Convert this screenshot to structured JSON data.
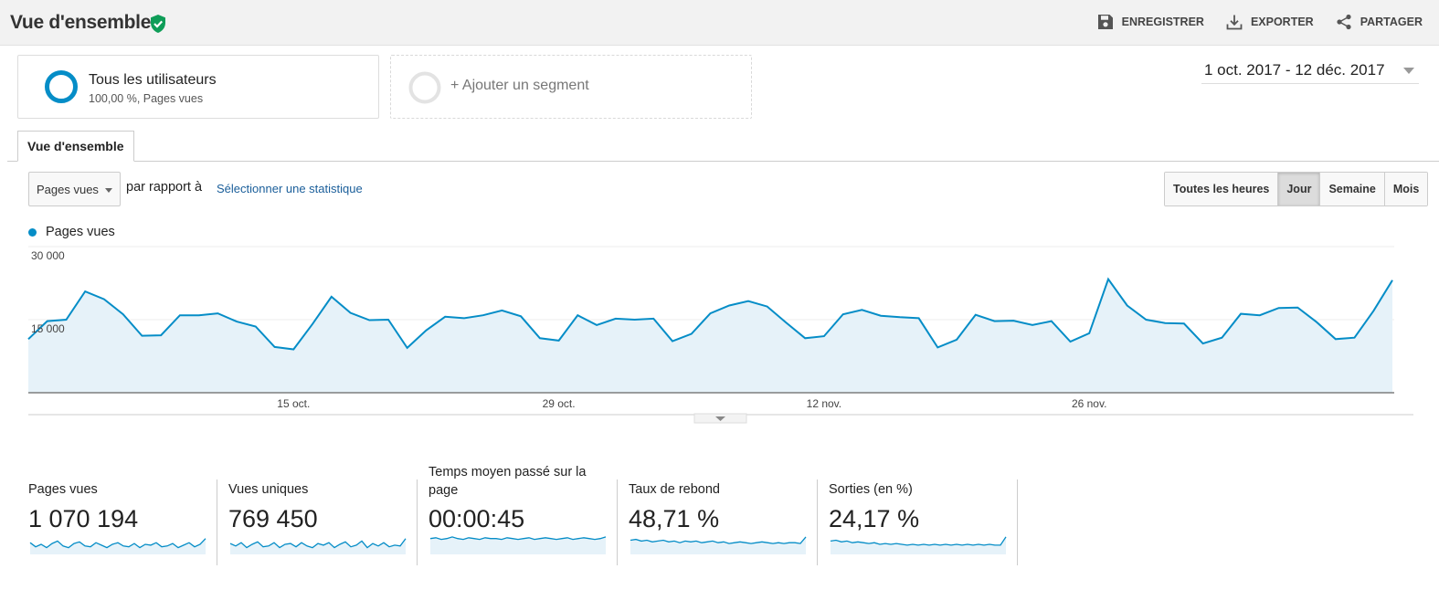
{
  "header": {
    "title": "Vue d'ensemble",
    "actions": [
      {
        "label": "ENREGISTRER",
        "icon": "save-icon"
      },
      {
        "label": "EXPORTER",
        "icon": "download-icon"
      },
      {
        "label": "PARTAGER",
        "icon": "share-icon"
      }
    ]
  },
  "segments": {
    "active": {
      "name": "Tous les utilisateurs",
      "detail": "100,00 %, Pages vues"
    },
    "add_label": "+ Ajouter un segment"
  },
  "date_range": "1 oct. 2017 - 12 déc. 2017",
  "tab": "Vue d'ensemble",
  "controls": {
    "metric": "Pages vues",
    "versus": "par rapport à",
    "select_stat": "Sélectionner une statistique",
    "granularity": [
      "Toutes les heures",
      "Jour",
      "Semaine",
      "Mois"
    ],
    "active_granularity": "Jour"
  },
  "colors": {
    "accent": "#058dc7",
    "area": "#e6f2f9",
    "good": "#0f9d58"
  },
  "chart_data": {
    "type": "area",
    "series": [
      {
        "name": "Pages vues"
      }
    ],
    "yticks": [
      "30 000",
      "15 000"
    ],
    "ylim": [
      0,
      30000
    ],
    "xticks": [
      "15 oct.",
      "29 oct.",
      "12 nov.",
      "26 nov."
    ],
    "x_tick_days": [
      14,
      28,
      42,
      56
    ],
    "x_start": "1 oct. 2017",
    "values": [
      11000,
      14700,
      15000,
      20800,
      19200,
      16100,
      11700,
      11800,
      15900,
      15900,
      16300,
      14600,
      13600,
      9400,
      8900,
      14100,
      19700,
      16400,
      14900,
      15000,
      9200,
      12800,
      15600,
      15300,
      15900,
      16900,
      15700,
      11200,
      10700,
      15900,
      13900,
      15200,
      15000,
      15200,
      10600,
      12100,
      16300,
      17900,
      18800,
      17700,
      14400,
      11200,
      11600,
      16100,
      17000,
      15800,
      15500,
      15300,
      9300,
      10900,
      16000,
      14700,
      14800,
      13900,
      14700,
      10500,
      12200,
      23300,
      17900,
      15000,
      14300,
      14200,
      10100,
      11300,
      16200,
      15900,
      17400,
      17500,
      14500,
      11000,
      11300,
      16800,
      23100
    ]
  },
  "kpis": [
    {
      "label": "Pages vues",
      "value": "1 070 194",
      "spark": [
        0.6,
        0.35,
        0.5,
        0.3,
        0.55,
        0.7,
        0.4,
        0.3,
        0.55,
        0.65,
        0.4,
        0.35,
        0.6,
        0.45,
        0.3,
        0.5,
        0.6,
        0.4,
        0.35,
        0.55,
        0.3,
        0.5,
        0.45,
        0.6,
        0.35,
        0.4,
        0.55,
        0.3,
        0.45,
        0.6,
        0.35,
        0.5,
        0.85
      ]
    },
    {
      "label": "Vues uniques",
      "value": "769 450",
      "spark": [
        0.55,
        0.4,
        0.6,
        0.3,
        0.5,
        0.65,
        0.35,
        0.4,
        0.6,
        0.3,
        0.5,
        0.55,
        0.35,
        0.6,
        0.4,
        0.3,
        0.55,
        0.45,
        0.6,
        0.3,
        0.5,
        0.65,
        0.35,
        0.45,
        0.7,
        0.3,
        0.55,
        0.4,
        0.6,
        0.35,
        0.45,
        0.4,
        0.85
      ]
    },
    {
      "label": "Temps moyen passé sur la page",
      "value": "00:00:45",
      "spark": [
        0.85,
        0.9,
        0.8,
        0.85,
        0.95,
        0.85,
        0.8,
        0.9,
        0.85,
        0.8,
        0.9,
        0.85,
        0.85,
        0.8,
        0.9,
        0.85,
        0.8,
        0.85,
        0.9,
        0.8,
        0.85,
        0.9,
        0.85,
        0.8,
        0.85,
        0.9,
        0.8,
        0.85,
        0.9,
        0.85,
        0.8,
        0.85,
        0.95
      ]
    },
    {
      "label": "Taux de rebond",
      "value": "48,71 %",
      "spark": [
        0.75,
        0.8,
        0.7,
        0.75,
        0.65,
        0.7,
        0.75,
        0.65,
        0.7,
        0.6,
        0.7,
        0.65,
        0.7,
        0.6,
        0.65,
        0.7,
        0.6,
        0.65,
        0.55,
        0.6,
        0.65,
        0.6,
        0.55,
        0.6,
        0.65,
        0.6,
        0.55,
        0.6,
        0.55,
        0.6,
        0.6,
        0.55,
        0.95
      ]
    },
    {
      "label": "Sorties (en %)",
      "value": "24,17 %",
      "spark": [
        0.7,
        0.75,
        0.65,
        0.7,
        0.6,
        0.65,
        0.6,
        0.55,
        0.6,
        0.5,
        0.55,
        0.5,
        0.55,
        0.5,
        0.45,
        0.5,
        0.45,
        0.5,
        0.45,
        0.5,
        0.45,
        0.5,
        0.45,
        0.5,
        0.45,
        0.5,
        0.45,
        0.5,
        0.45,
        0.5,
        0.45,
        0.45,
        0.95
      ]
    }
  ]
}
